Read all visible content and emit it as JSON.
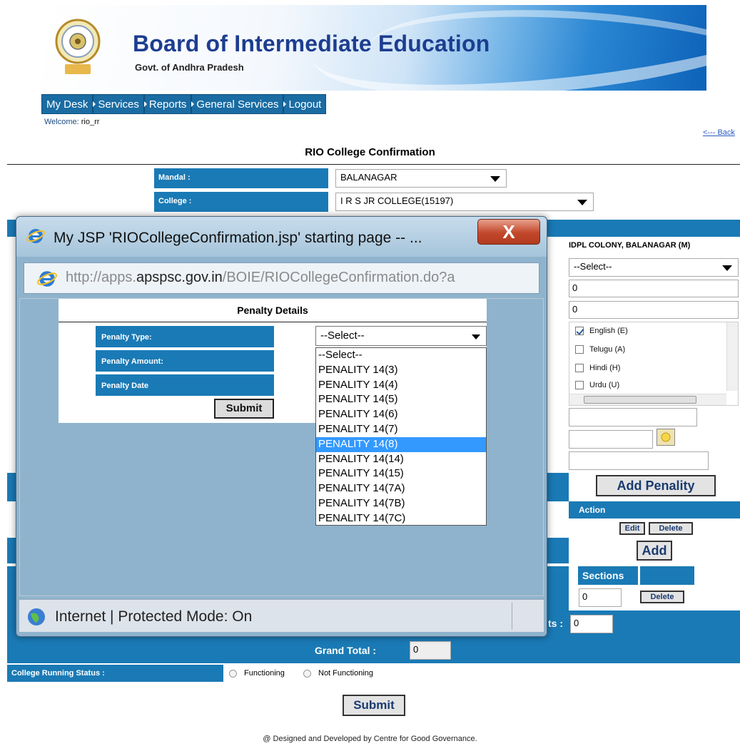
{
  "header": {
    "title": "Board of Intermediate Education",
    "subtitle": "Govt. of Andhra Pradesh"
  },
  "menu": [
    "My Desk",
    "Services",
    "Reports",
    "General Services",
    "Logout"
  ],
  "welcome": {
    "label": "Welcome:",
    "user": "rio_rr"
  },
  "back_link": "<--- Back",
  "page_title": "RIO College Confirmation",
  "form": {
    "mandal_label": "Mandal :",
    "mandal_value": "BALANAGAR",
    "college_label": "College :",
    "college_value": "I R S JR COLLEGE(15197)",
    "address_value": "IDPL COLONY, BALANAGAR (M)",
    "select_placeholder": "--Select--",
    "field1_value": "0",
    "field2_value": "0",
    "languages": [
      {
        "label": "English (E)",
        "checked": true
      },
      {
        "label": "Telugu (A)",
        "checked": false
      },
      {
        "label": "Hindi (H)",
        "checked": false
      },
      {
        "label": "Urdu (U)",
        "checked": false
      }
    ],
    "add_penality_label": "Add Penality",
    "action_header": "Action",
    "edit_label": "Edit",
    "delete_label": "Delete",
    "add_label": "Add",
    "sections_header": "Sections",
    "sections_value": "0",
    "delete2_label": "Delete",
    "students_suffix": "ts :",
    "students_value": "0",
    "grand_total_label": "Grand Total :",
    "grand_total_value": "0",
    "running_status_label": "College Running Status :",
    "functioning_label": "Functioning",
    "not_functioning_label": "Not Functioning",
    "submit_label": "Submit"
  },
  "footer": "@ Designed and Developed by Centre for Good Governance.",
  "popup": {
    "title": "My JSP 'RIOCollegeConfirmation.jsp' starting page -- ...",
    "close_label": "X",
    "url_prefix": "http://apps.",
    "url_domain": "apspsc.gov.in",
    "url_rest": "/BOIE/RIOCollegeConfirmation.do?a",
    "panel_title": "Penalty Details",
    "penalty_type_label": "Penalty Type:",
    "penalty_amount_label": "Penalty Amount:",
    "penalty_date_label": "Penalty Date",
    "submit_label": "Submit",
    "select_value": "--Select--",
    "options": [
      "--Select--",
      "PENALITY 14(3)",
      "PENALITY 14(4)",
      "PENALITY 14(5)",
      "PENALITY 14(6)",
      "PENALITY 14(7)",
      "PENALITY 14(8)",
      "PENALITY 14(14)",
      "PENALITY 14(15)",
      "PENALITY 14(7A)",
      "PENALITY 14(7B)",
      "PENALITY 14(7C)"
    ],
    "highlighted_option": "PENALITY 14(8)",
    "status": "Internet | Protected Mode: On"
  }
}
